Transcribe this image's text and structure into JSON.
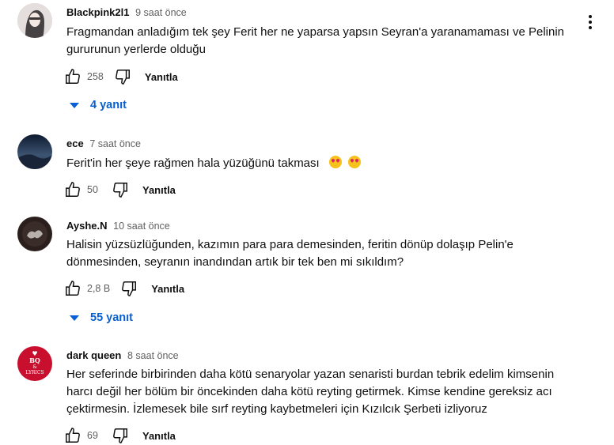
{
  "comments": [
    {
      "author": "Blackpink2l1",
      "time": "9 saat önce",
      "text": "Fragmandan anladığım tek şey Ferit her ne yaparsa yapsın Seyran'a yaranamaması ve Pelinin gururunun yerlerde olduğu",
      "likes": "258",
      "reply_label": "Yanıtla",
      "replies_label": "4 yanıt"
    },
    {
      "author": "ece",
      "time": "7 saat önce",
      "text": "Ferit'in her şeye rağmen hala yüzüğünü takması",
      "emojis": [
        "star-struck-emoji",
        "heart-eyes-emoji"
      ],
      "likes": "50",
      "reply_label": "Yanıtla"
    },
    {
      "author": "Ayshe.N",
      "time": "10 saat önce",
      "text": "Halisin yüzsüzlüğunden, kazımın para para demesinden, feritin dönüp dolaşıp Pelin'e dönmesinden, seyranın inandından artık bir tek ben mi sıkıldım?",
      "likes": "2,8 B",
      "reply_label": "Yanıtla",
      "replies_label": "55 yanıt"
    },
    {
      "author": "dark queen",
      "time": "8 saat önce",
      "text": "Her seferinde birbirinden daha kötü senaryolar yazan senaristi burdan tebrik edelim kimsenin harcı değil her bölüm bir öncekinden daha kötü reyting getirmek. Kimse kendine gereksiz acı çektirmesin. İzlemesek bile sırf reyting kaybetmeleri için Kızılcık Şerbeti izliyoruz",
      "likes": "69",
      "reply_label": "Yanıtla",
      "avatar_text": [
        "BQ",
        "&",
        "LYRICS"
      ]
    }
  ],
  "colors": {
    "link_blue": "#065fd4",
    "muted": "#606060",
    "text": "#0f0f0f"
  },
  "icons": [
    "like-icon",
    "dislike-icon",
    "more-vert-icon",
    "expand-triangle-icon"
  ]
}
